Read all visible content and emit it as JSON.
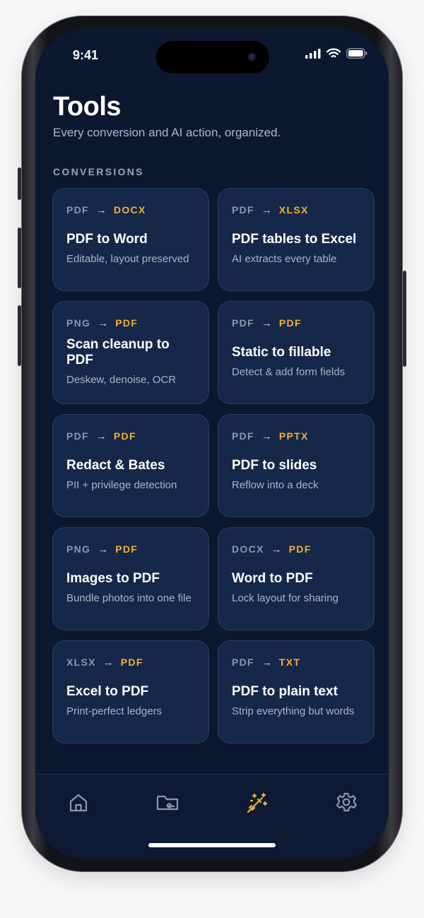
{
  "status": {
    "time": "9:41"
  },
  "header": {
    "title": "Tools",
    "subtitle": "Every conversion and AI action, organized."
  },
  "section_label": "CONVERSIONS",
  "cards": [
    {
      "from": "PDF",
      "to": "DOCX",
      "name": "PDF to Word",
      "desc": "Editable, layout preserved"
    },
    {
      "from": "PDF",
      "to": "XLSX",
      "name": "PDF tables to Excel",
      "desc": "AI extracts every table"
    },
    {
      "from": "PNG",
      "to": "PDF",
      "name": "Scan cleanup to PDF",
      "desc": "Deskew, denoise, OCR"
    },
    {
      "from": "PDF",
      "to": "PDF",
      "name": "Static to fillable",
      "desc": "Detect & add form fields"
    },
    {
      "from": "PDF",
      "to": "PDF",
      "name": "Redact & Bates",
      "desc": "PII + privilege detection"
    },
    {
      "from": "PDF",
      "to": "PPTX",
      "name": "PDF to slides",
      "desc": "Reflow into a deck"
    },
    {
      "from": "PNG",
      "to": "PDF",
      "name": "Images to PDF",
      "desc": "Bundle photos into one file"
    },
    {
      "from": "DOCX",
      "to": "PDF",
      "name": "Word to PDF",
      "desc": "Lock layout for sharing"
    },
    {
      "from": "XLSX",
      "to": "PDF",
      "name": "Excel to PDF",
      "desc": "Print-perfect ledgers"
    },
    {
      "from": "PDF",
      "to": "TXT",
      "name": "PDF to plain text",
      "desc": "Strip everything but words"
    }
  ],
  "arrow_glyph": "→",
  "tabs": [
    {
      "icon": "home-icon",
      "active": false
    },
    {
      "icon": "folder-icon",
      "active": false
    },
    {
      "icon": "magic-wand-icon",
      "active": true
    },
    {
      "icon": "gear-icon",
      "active": false
    }
  ],
  "colors": {
    "background": "#0c1730",
    "card": "#16284a",
    "accent": "#f2b233",
    "muted": "#8c97ae",
    "tab_inactive": "#8d97ad"
  }
}
